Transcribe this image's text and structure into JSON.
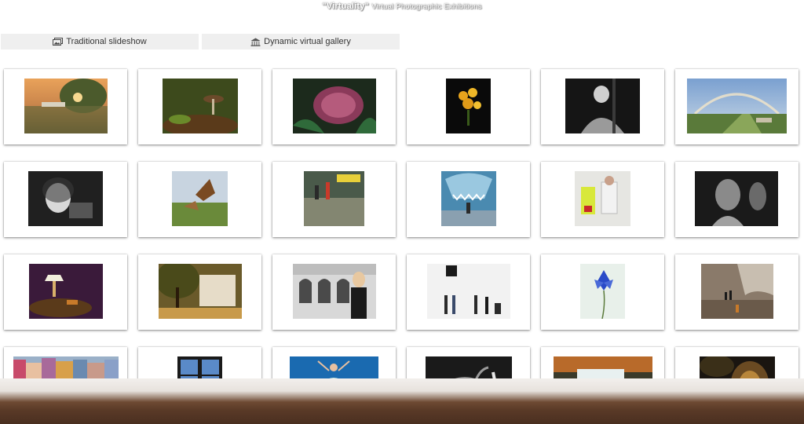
{
  "header": {
    "title_main": "\"Virtuality\"",
    "title_sub": "Virtual Photographic Exhibitions"
  },
  "modes": [
    {
      "label": "Traditional slideshow",
      "icon": "slideshow-icon"
    },
    {
      "label": "Dynamic virtual gallery",
      "icon": "gallery-icon"
    }
  ],
  "colors": {
    "mode_bg": "#efefef",
    "frame_bg": "#ffffff",
    "floor": "#5a3a27"
  }
}
